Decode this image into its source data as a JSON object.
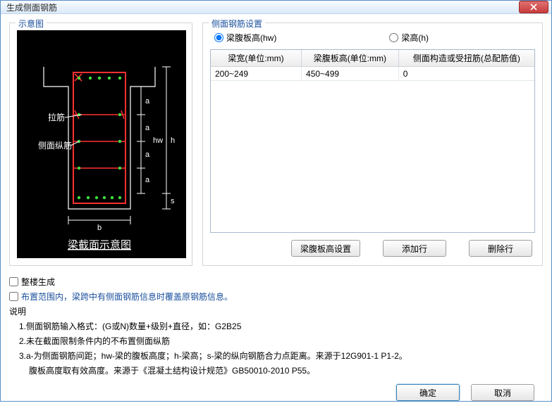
{
  "titlebar": {
    "title": "生成侧面钢筋"
  },
  "schematic": {
    "legend": "示意图",
    "rebar_tie": "拉筋",
    "rebar_side": "侧面纵筋",
    "caption": "梁截面示意图",
    "dim_a": "a",
    "dim_hw": "hw",
    "dim_h": "h",
    "dim_s": "s",
    "dim_b": "b"
  },
  "settings": {
    "legend": "侧面钢筋设置",
    "radio_hw": "梁腹板高(hw)",
    "radio_h": "梁高(h)",
    "columns": [
      "梁宽(单位:mm)",
      "梁腹板高(单位:mm)",
      "侧面构造或受扭筋(总配筋值)"
    ],
    "rows": [
      {
        "width": "200~249",
        "hw": "450~499",
        "rebar": "0"
      }
    ],
    "btn_hw_setting": "梁腹板高设置",
    "btn_add": "添加行",
    "btn_del": "删除行"
  },
  "options": {
    "whole_building": "整楼生成",
    "override": "布置范围内，梁跨中有侧面钢筋信息时覆盖原钢筋信息。"
  },
  "notes": {
    "title": "说明",
    "items": [
      "1.侧面钢筋输入格式：(G或N)数量+级别+直径，如：G2B25",
      "2.未在截面限制条件内的不布置侧面纵筋",
      "3.a-为侧面钢筋间距；hw-梁的腹板高度；h-梁高；s-梁的纵向钢筋合力点距离。来源于12G901-1 P1-2。"
    ],
    "sub": "腹板高度取有效高度。来源于《混凝土结构设计规范》GB50010-2010 P55。"
  },
  "footer": {
    "ok": "确定",
    "cancel": "取消"
  }
}
